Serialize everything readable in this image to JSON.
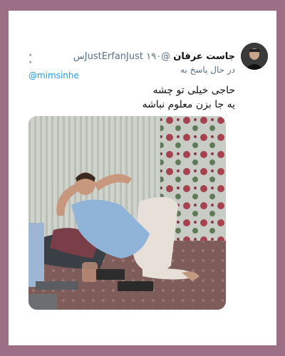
{
  "tweet": {
    "display_name": "جاست عرفان",
    "handle": "@JustErfanJust",
    "time": "۱۹۰س",
    "replying_prefix": "در حال پاسخ به",
    "replying_to": "@mimsinhe",
    "text_line1": "حاجی خیلی تو چشه",
    "text_line2": "یه جا بزن معلوم نباشه"
  },
  "colors": {
    "frame": "#9c6f86",
    "link": "#1d9bf0",
    "muted": "#5b7083"
  }
}
